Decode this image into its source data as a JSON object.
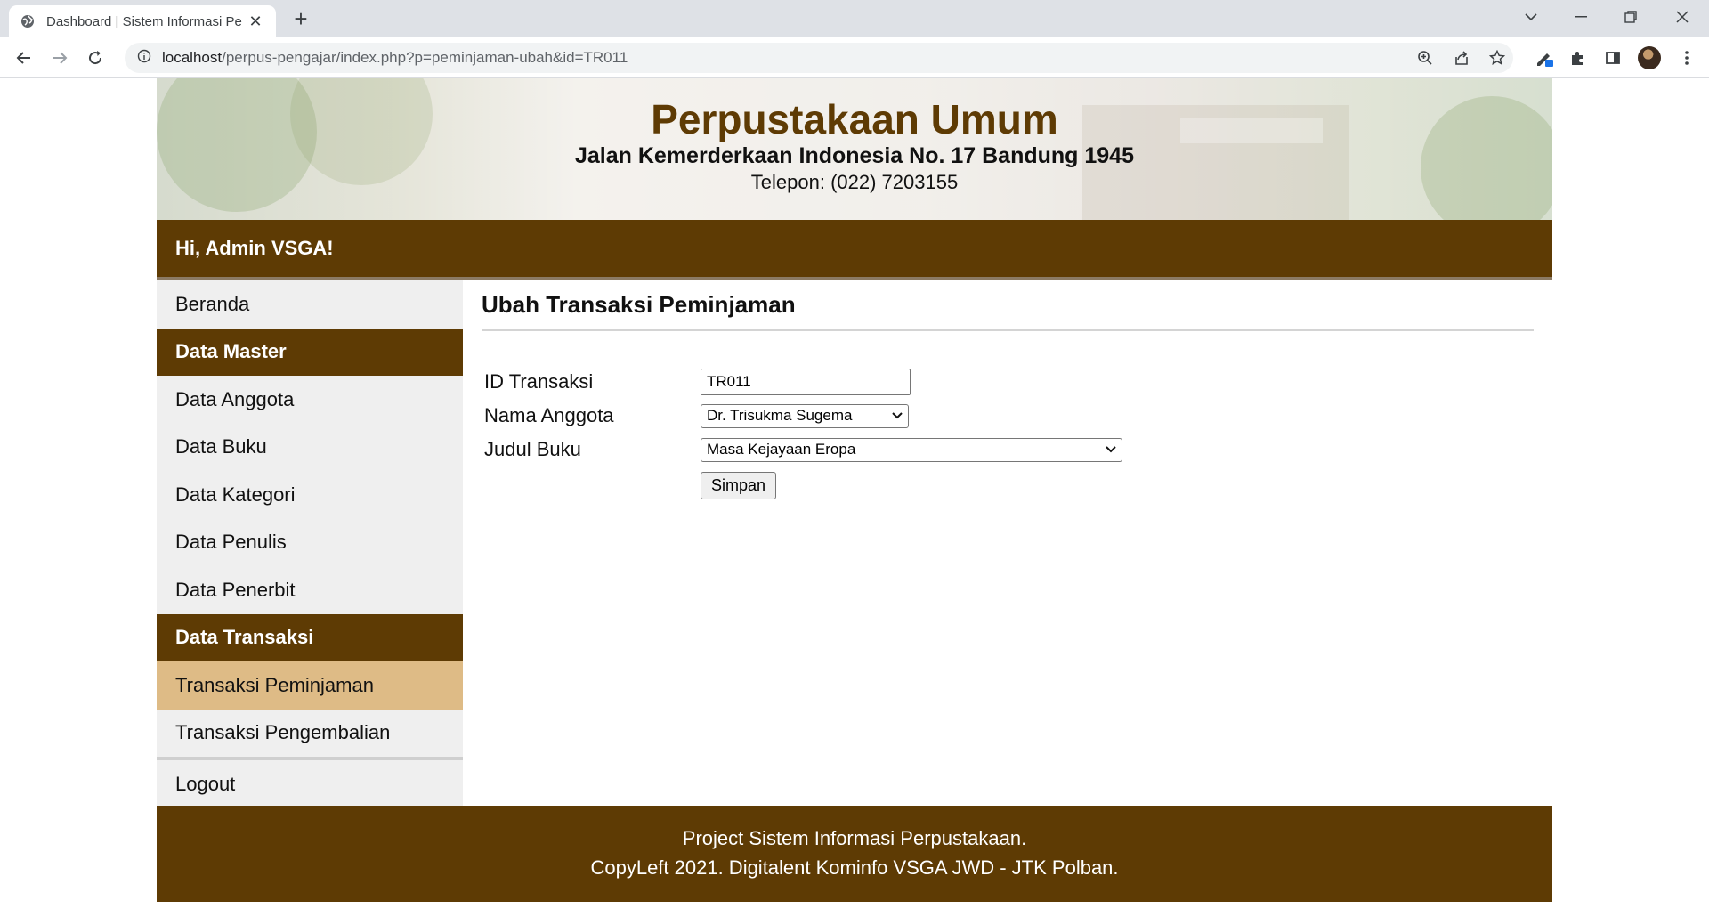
{
  "browser": {
    "tab_title": "Dashboard | Sistem Informasi Pe",
    "url_host": "localhost",
    "url_path": "/perpus-pengajar/index.php?p=peminjaman-ubah&id=TR011"
  },
  "header": {
    "title": "Perpustakaan Umum",
    "address": "Jalan Kemerderkaan Indonesia No. 17 Bandung 1945",
    "phone": "Telepon: (022) 7203155"
  },
  "greeting": "Hi, Admin VSGA!",
  "sidebar": {
    "items": [
      {
        "label": "Beranda"
      },
      {
        "label": "Data Master"
      },
      {
        "label": "Data Anggota"
      },
      {
        "label": "Data Buku"
      },
      {
        "label": "Data Kategori"
      },
      {
        "label": "Data Penulis"
      },
      {
        "label": "Data Penerbit"
      },
      {
        "label": "Data Transaksi"
      },
      {
        "label": "Transaksi Peminjaman"
      },
      {
        "label": "Transaksi Pengembalian"
      },
      {
        "label": "Logout"
      }
    ]
  },
  "main": {
    "title": "Ubah Transaksi Peminjaman",
    "form": {
      "id_label": "ID Transaksi",
      "id_value": "TR011",
      "member_label": "Nama Anggota",
      "member_value": "Dr. Trisukma Sugema",
      "book_label": "Judul Buku",
      "book_value": "Masa Kejayaan Eropa",
      "submit_label": "Simpan"
    }
  },
  "footer": {
    "line1": "Project Sistem Informasi Perpustakaan.",
    "line2": "CopyLeft 2021. Digitalent Kominfo VSGA JWD - JTK Polban."
  },
  "colors": {
    "brand_brown": "#5e3b04",
    "active_item": "#debb86",
    "sidebar_bg": "#efefef"
  }
}
